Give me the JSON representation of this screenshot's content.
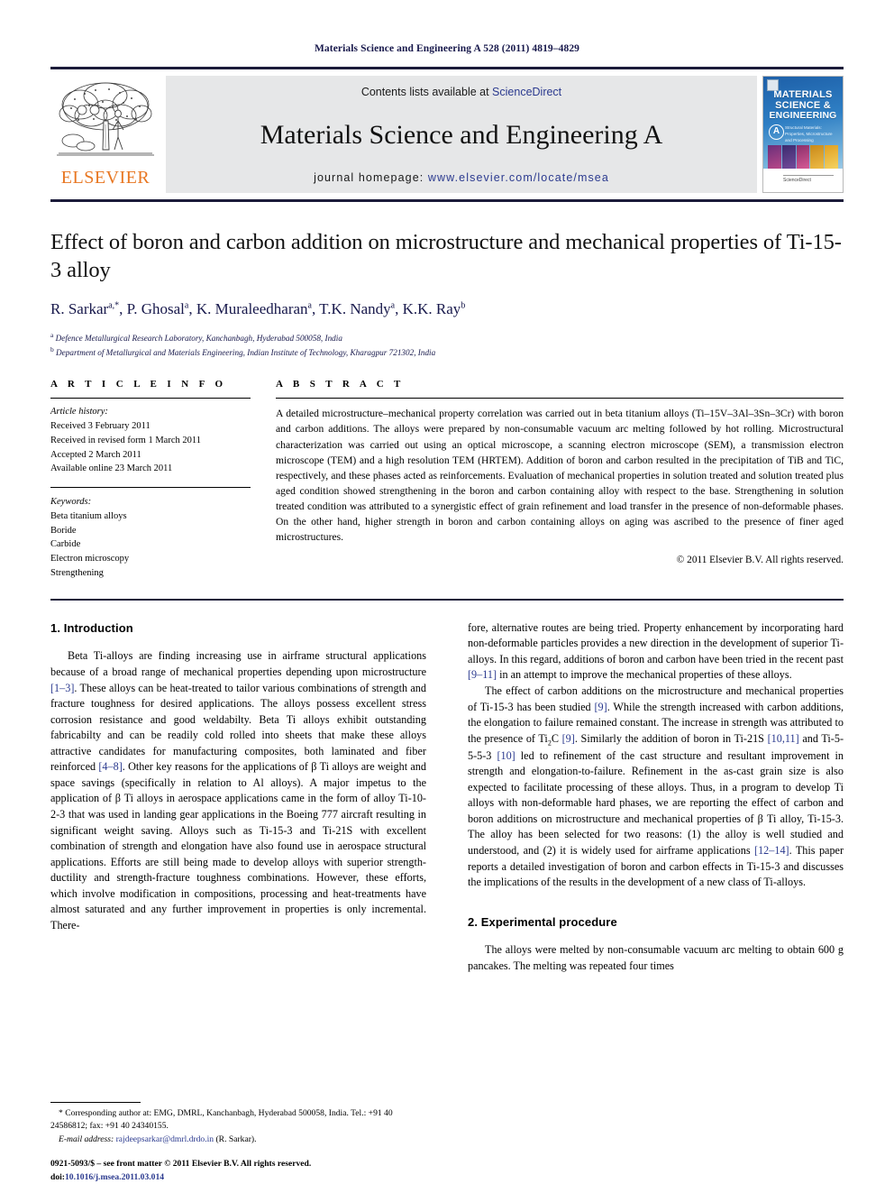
{
  "running_head": "Materials Science and Engineering A 528 (2011) 4819–4829",
  "masthead": {
    "contents_prefix": "Contents lists available at ",
    "sciencedirect": "ScienceDirect",
    "journal_title": "Materials Science and Engineering A",
    "homepage_prefix": "journal homepage:",
    "homepage_url": "www.elsevier.com/locate/msea",
    "publisher_wordmark": "ELSEVIER",
    "accent_orange": "#e87722",
    "link_blue": "#2b3a8f",
    "rule_color": "#1b1b3a",
    "cover": {
      "line1": "MATERIALS",
      "line2": "SCIENCE &",
      "line3": "ENGINEERING",
      "badge": "A",
      "subtitle": "Structural Materials: Properties, Microstructure and Processing",
      "footer": "ScienceDirect"
    }
  },
  "article": {
    "title": "Effect of boron and carbon addition on microstructure and mechanical properties of Ti-15-3 alloy",
    "authors_html": "R. Sarkar<sup>a,*</sup>, P. Ghosal<sup>a</sup>, K. Muraleedharan<sup>a</sup>, T.K. Nandy<sup>a</sup>, K.K. Ray<sup>b</sup>",
    "affiliations": [
      {
        "marker": "a",
        "text": "Defence Metallurgical Research Laboratory, Kanchanbagh, Hyderabad 500058, India"
      },
      {
        "marker": "b",
        "text": "Department of Metallurgical and Materials Engineering, Indian Institute of Technology, Kharagpur 721302, India"
      }
    ]
  },
  "article_info": {
    "label": "A R T I C L E    I N F O",
    "history_heading": "Article history:",
    "history": [
      "Received 3 February 2011",
      "Received in revised form 1 March 2011",
      "Accepted 2 March 2011",
      "Available online 23 March 2011"
    ],
    "keywords_heading": "Keywords:",
    "keywords": [
      "Beta titanium alloys",
      "Boride",
      "Carbide",
      "Electron microscopy",
      "Strengthening"
    ]
  },
  "abstract": {
    "label": "A B S T R A C T",
    "text": "A detailed microstructure–mechanical property correlation was carried out in beta titanium alloys (Ti–15V–3Al–3Sn–3Cr) with boron and carbon additions. The alloys were prepared by non-consumable vacuum arc melting followed by hot rolling. Microstructural characterization was carried out using an optical microscope, a scanning electron microscope (SEM), a transmission electron microscope (TEM) and a high resolution TEM (HRTEM). Addition of boron and carbon resulted in the precipitation of TiB and TiC, respectively, and these phases acted as reinforcements. Evaluation of mechanical properties in solution treated and solution treated plus aged condition showed strengthening in the boron and carbon containing alloy with respect to the base. Strengthening in solution treated condition was attributed to a synergistic effect of grain refinement and load transfer in the presence of non-deformable phases. On the other hand, higher strength in boron and carbon containing alloys on aging was ascribed to the presence of finer aged microstructures.",
    "copyright": "© 2011 Elsevier B.V. All rights reserved."
  },
  "body": {
    "intro_heading": "1.  Introduction",
    "intro_p1_html": "Beta Ti-alloys are finding increasing use in airframe structural applications because of a broad range of mechanical properties depending upon microstructure <span class=\"ref\">[1–3]</span>. These alloys can be heat-treated to tailor various combinations of strength and fracture toughness for desired applications. The alloys possess excellent stress corrosion resistance and good weldabilty. Beta Ti alloys exhibit outstanding fabricabilty and can be readily cold rolled into sheets that make these alloys attractive candidates for manufacturing composites, both laminated and fiber reinforced <span class=\"ref\">[4–8]</span>. Other key reasons for the applications of β Ti alloys are weight and space savings (specifically in relation to Al alloys). A major impetus to the application of β Ti alloys in aerospace applications came in the form of alloy Ti-10-2-3 that was used in landing gear applications in the Boeing 777 aircraft resulting in significant weight saving. Alloys such as Ti-15-3 and Ti-21S with excellent combination of strength and elongation have also found use in aerospace structural applications. Efforts are still being made to develop alloys with superior strength-ductility and strength-fracture toughness combinations. However, these efforts, which involve modification in compositions, processing and heat-treatments have almost saturated and any further improvement in properties is only incremental. There-",
    "intro_p1_cont_html": "fore, alternative routes are being tried. Property enhancement by incorporating hard non-deformable particles provides a new direction in the development of superior Ti-alloys. In this regard, additions of boron and carbon have been tried in the recent past <span class=\"ref\">[9–11]</span> in an attempt to improve the mechanical properties of these alloys.",
    "intro_p2_html": "The effect of carbon additions on the microstructure and mechanical properties of Ti-15-3 has been studied <span class=\"ref\">[9]</span>. While the strength increased with carbon additions, the elongation to failure remained constant. The increase in strength was attributed to the presence of Ti<sub>2</sub>C <span class=\"ref\">[9]</span>. Similarly the addition of boron in Ti-21S <span class=\"ref\">[10,11]</span> and Ti-5-5-5-3 <span class=\"ref\">[10]</span> led to refinement of the cast structure and resultant improvement in strength and elongation-to-failure. Refinement in the as-cast grain size is also expected to facilitate processing of these alloys. Thus, in a program to develop Ti alloys with non-deformable hard phases, we are reporting the effect of carbon and boron additions on microstructure and mechanical properties of β Ti alloy, Ti-15-3. The alloy has been selected for two reasons: (1) the alloy is well studied and understood, and (2) it is widely used for airframe applications <span class=\"ref\">[12–14]</span>. This paper reports a detailed investigation of boron and carbon effects in Ti-15-3 and discusses the implications of the results in the development of a new class of Ti-alloys.",
    "exp_heading": "2.  Experimental procedure",
    "exp_p1": "The alloys were melted by non-consumable vacuum arc melting to obtain 600 g pancakes. The melting was repeated four times"
  },
  "footnote": {
    "corresponding_html": "* Corresponding author at: EMG, DMRL, Kanchanbagh, Hyderabad 500058, India. Tel.: +91 40 24586812; fax: +91 40 24340155.",
    "email_label": "E-mail address:",
    "email": "rajdeepsarkar@dmrl.drdo.in",
    "email_owner": "(R. Sarkar)."
  },
  "issn": {
    "line1": "0921-5093/$ – see front matter © 2011 Elsevier B.V. All rights reserved.",
    "doi_label": "doi:",
    "doi_value": "10.1016/j.msea.2011.03.014"
  }
}
